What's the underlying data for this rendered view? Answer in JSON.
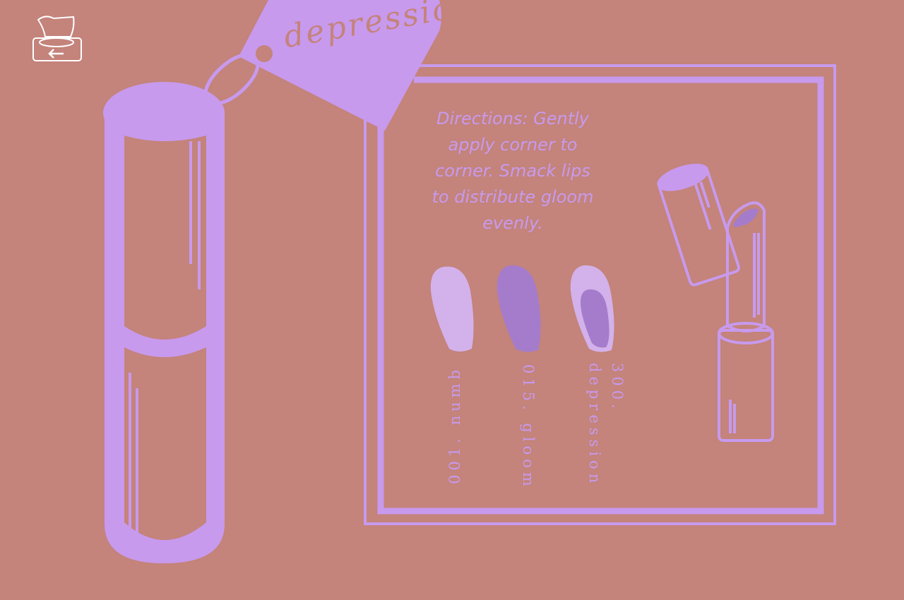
{
  "nav": {
    "back_icon": "tissue-box-back-arrow-icon"
  },
  "tag": {
    "text": "depression"
  },
  "directions": {
    "line1": "Directions: Gently",
    "line2": "apply corner to",
    "line3": "corner. Smack lips",
    "line4": "to distribute gloom",
    "line5": "evenly."
  },
  "shades": [
    {
      "label": "001. numb",
      "color": "#d3b1ea"
    },
    {
      "label": "015. gloom",
      "color": "#a57ccb"
    },
    {
      "number": "300.",
      "name": "depression",
      "color": "#a57ccb",
      "outer_color": "#d3b1ea"
    }
  ],
  "colors": {
    "background": "#c4837b",
    "accent": "#c79aee",
    "outline": "#ffffff"
  }
}
